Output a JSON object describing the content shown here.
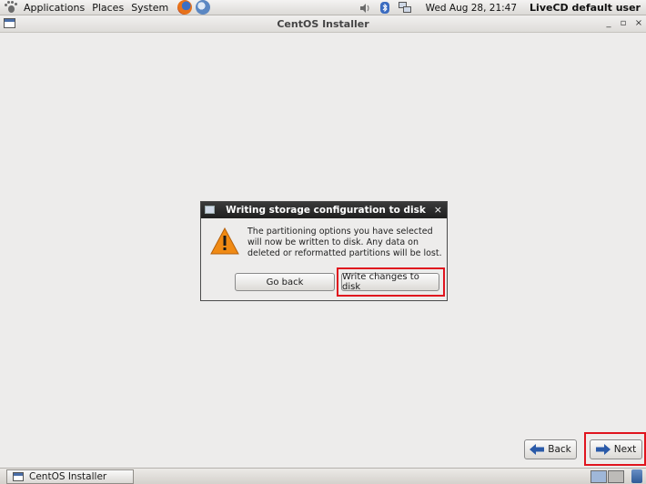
{
  "top_panel": {
    "menus": [
      "Applications",
      "Places",
      "System"
    ],
    "clock": "Wed Aug 28, 21:47",
    "user": "LiveCD default user"
  },
  "window": {
    "title": "CentOS Installer",
    "controls": {
      "minimize": "_",
      "maximize": "▫",
      "close": "×"
    }
  },
  "dialog": {
    "title": "Writing storage configuration to disk",
    "close": "×",
    "message": "The partitioning options you have selected will now be written to disk.  Any data on deleted or reformatted partitions will be lost.",
    "go_back_label": "Go back",
    "write_label": "Write changes to disk"
  },
  "nav": {
    "back_label": "Back",
    "next_label": "Next"
  },
  "taskbar": {
    "task_label": "CentOS Installer"
  },
  "colors": {
    "highlight": "#e0141e",
    "arrow_blue": "#2a5aa8",
    "warning_orange": "#f08a14"
  }
}
